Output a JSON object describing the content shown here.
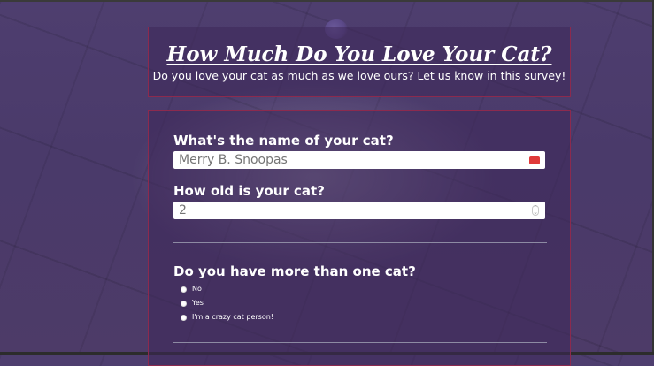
{
  "header": {
    "title": "How Much Do You Love Your Cat?",
    "subtitle": "Do you love your cat as much as we love ours? Let us know in this survey!"
  },
  "form": {
    "name_question": {
      "label": "What's the name of your cat?",
      "placeholder": "Merry B. Snoopas",
      "value": ""
    },
    "age_question": {
      "label": "How old is your cat?",
      "placeholder": "2",
      "value": ""
    },
    "multi_cat_question": {
      "label": "Do you have more than one cat?",
      "options": [
        {
          "label": "No"
        },
        {
          "label": "Yes"
        },
        {
          "label": "I'm a crazy cat person!"
        }
      ]
    }
  },
  "colors": {
    "panel_border": "#8c2a4e",
    "panel_background": "#3e285a",
    "input_icon": "#e03a3a"
  },
  "icons": {
    "name_field_icon": "password-dots-icon",
    "age_field_icon": "number-spinner-icon"
  }
}
